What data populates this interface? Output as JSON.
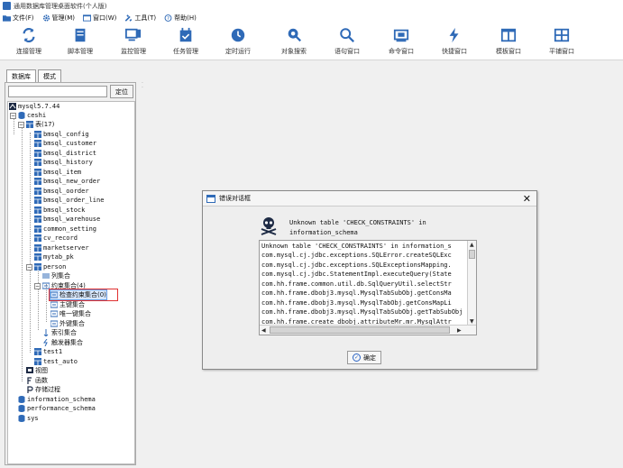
{
  "window": {
    "title": "通用数据库管理桌面软件(个人版)"
  },
  "menubar": [
    {
      "label": "文件(F)",
      "icon": "folder-icon"
    },
    {
      "label": "管理(M)",
      "icon": "gear-icon"
    },
    {
      "label": "窗口(W)",
      "icon": "window-icon"
    },
    {
      "label": "工具(T)",
      "icon": "tools-icon"
    },
    {
      "label": "帮助(H)",
      "icon": "help-icon"
    }
  ],
  "toolbar": [
    {
      "label": "连接管理",
      "icon": "refresh-icon"
    },
    {
      "label": "脚本管理",
      "icon": "script-icon"
    },
    {
      "label": "监控管理",
      "icon": "monitor-icon"
    },
    {
      "label": "任务管理",
      "icon": "calendar-icon"
    },
    {
      "label": "定时运行",
      "icon": "clock-icon"
    },
    {
      "label": "对象搜索",
      "icon": "object-search-icon"
    },
    {
      "label": "语句窗口",
      "icon": "search-icon"
    },
    {
      "label": "命令窗口",
      "icon": "terminal-icon"
    },
    {
      "label": "快捷窗口",
      "icon": "lightning-icon"
    },
    {
      "label": "模板窗口",
      "icon": "template-icon"
    },
    {
      "label": "平铺窗口",
      "icon": "tile-icon"
    }
  ],
  "left_panel": {
    "tabs": [
      "数据库",
      "模式"
    ],
    "search_placeholder": "",
    "locate_label": "定位",
    "tree": [
      {
        "label": "mysql5.7.44",
        "icon": "server-icon"
      },
      {
        "label": "ceshi",
        "icon": "database-icon"
      },
      {
        "label": "表(17)",
        "icon": "table-icon"
      },
      {
        "label": "bmsql_config",
        "icon": "table-icon"
      },
      {
        "label": "bmsql_customer",
        "icon": "table-icon"
      },
      {
        "label": "bmsql_district",
        "icon": "table-icon"
      },
      {
        "label": "bmsql_history",
        "icon": "table-icon"
      },
      {
        "label": "bmsql_item",
        "icon": "table-icon"
      },
      {
        "label": "bmsql_new_order",
        "icon": "table-icon"
      },
      {
        "label": "bmsql_oorder",
        "icon": "table-icon"
      },
      {
        "label": "bmsql_order_line",
        "icon": "table-icon"
      },
      {
        "label": "bmsql_stock",
        "icon": "table-icon"
      },
      {
        "label": "bmsql_warehouse",
        "icon": "table-icon"
      },
      {
        "label": "common_setting",
        "icon": "table-icon"
      },
      {
        "label": "cv_record",
        "icon": "table-icon"
      },
      {
        "label": "marketserver",
        "icon": "table-icon"
      },
      {
        "label": "mytab_pk",
        "icon": "table-icon"
      },
      {
        "label": "person",
        "icon": "table-icon"
      },
      {
        "label": "列集合",
        "icon": "columns-icon"
      },
      {
        "label": "约束集合(4)",
        "icon": "constraint-icon"
      },
      {
        "label": "检查约束集合(0)",
        "icon": "constraint-icon"
      },
      {
        "label": "主键集合",
        "icon": "constraint-icon"
      },
      {
        "label": "唯一键集合",
        "icon": "constraint-icon"
      },
      {
        "label": "外键集合",
        "icon": "constraint-icon"
      },
      {
        "label": "索引集合",
        "icon": "index-icon"
      },
      {
        "label": "触发器集合",
        "icon": "trigger-icon"
      },
      {
        "label": "test1",
        "icon": "table-icon"
      },
      {
        "label": "test_auto",
        "icon": "table-icon"
      },
      {
        "label": "视图",
        "icon": "view-icon"
      },
      {
        "label": "函数",
        "icon": "function-icon"
      },
      {
        "label": "存储过程",
        "icon": "procedure-icon"
      },
      {
        "label": "information_schema",
        "icon": "database-icon"
      },
      {
        "label": "performance_schema",
        "icon": "database-icon"
      },
      {
        "label": "sys",
        "icon": "database-icon"
      }
    ]
  },
  "dialog": {
    "title": "错误对话框",
    "close": "✕",
    "icon": "skull-icon",
    "message_line1": "Unknown table 'CHECK_CONSTRAINTS' in",
    "message_line2": "information_schema",
    "stack": [
      "Unknown table 'CHECK_CONSTRAINTS' in information_s",
      "com.mysql.cj.jdbc.exceptions.SQLError.createSQLExc",
      "com.mysql.cj.jdbc.exceptions.SQLExceptionsMapping.",
      "com.mysql.cj.jdbc.StatementImpl.executeQuery(State",
      "com.hh.frame.common.util.db.SqlQueryUtil.selectStr",
      "com.hh.frame.dbobj3.mysql.MysqlTabSubObj.getConsMa",
      "com.hh.frame.dbobj3.mysql.MysqlTabObj.getConsMapLi",
      "com.hh.frame.dbobj3.mysql.MysqlTabSubObj.getTabSubObj",
      "com.hh.frame.create dbobj.attributeMr.mr.MysqlAttr"
    ],
    "ok_label": "确定"
  },
  "colors": {
    "accent": "#2f6ab7",
    "selection": "#d7e6fb",
    "highlight": "#e03030"
  }
}
